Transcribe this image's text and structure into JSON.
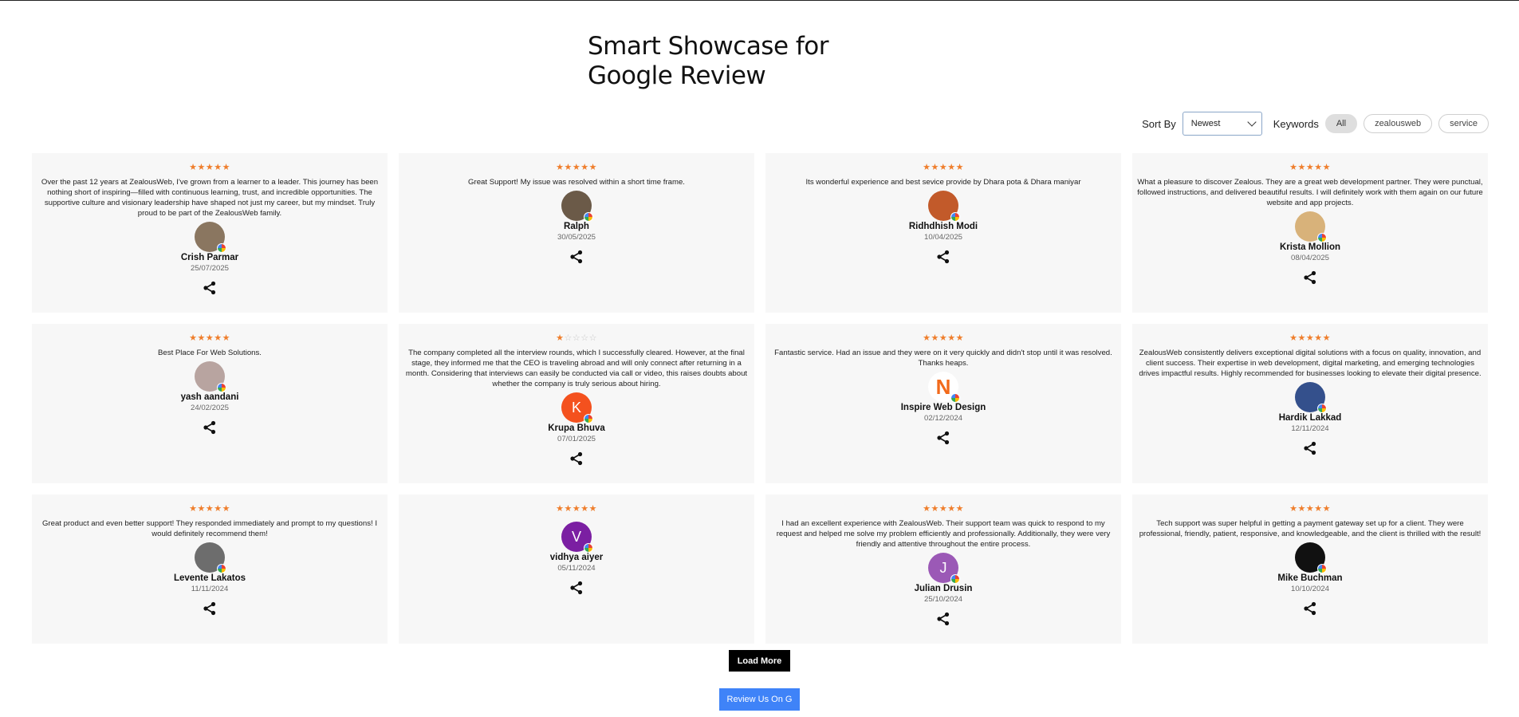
{
  "title": {
    "line1": "Smart Showcase for",
    "line2": "Google Review"
  },
  "filters": {
    "sort_label": "Sort By",
    "sort_value": "Newest",
    "keywords_label": "Keywords",
    "chips": [
      "All",
      "zealousweb",
      "service"
    ]
  },
  "reviews": [
    {
      "rating": 5,
      "text": "Over the past 12 years at ZealousWeb, I've grown from a learner to a leader. This journey has been nothing short of inspiring—filled with continuous learning, trust, and incredible opportunities. The supportive culture and visionary leadership have shaped not just my career, but my mindset. Truly proud to be part of the ZealousWeb family.",
      "name": "Crish Parmar",
      "date": "25/07/2025",
      "avatar_color": "#8a7660",
      "initial": ""
    },
    {
      "rating": 5,
      "text": "Great Support! My issue was resolved within a short time frame.",
      "name": "Ralph",
      "date": "30/05/2025",
      "avatar_color": "#6b5a48",
      "initial": ""
    },
    {
      "rating": 5,
      "text": "Its wonderful experience and best sevice provide by Dhara pota & Dhara maniyar",
      "name": "Ridhdhish Modi",
      "date": "10/04/2025",
      "avatar_color": "#c25a2a",
      "initial": ""
    },
    {
      "rating": 5,
      "text": "What a pleasure to discover Zealous. They are a great web development partner. They were punctual, followed instructions, and delivered beautiful results. I will definitely work with them again on our future website and app projects.",
      "name": "Krista Mollion",
      "date": "08/04/2025",
      "avatar_color": "#d8b27a",
      "initial": ""
    },
    {
      "rating": 5,
      "text": "Best Place For Web Solutions.",
      "name": "yash aandani",
      "date": "24/02/2025",
      "avatar_color": "#b8a4a0",
      "initial": ""
    },
    {
      "rating": 1,
      "text": "The company completed all the interview rounds, which I successfully cleared. However, at the final stage, they informed me that the CEO is traveling abroad and will only connect after returning in a month. Considering that interviews can easily be conducted via call or video, this raises doubts about whether the company is truly serious about hiring.",
      "name": "Krupa Bhuva",
      "date": "07/01/2025",
      "avatar_color": "#f4511e",
      "initial": "K"
    },
    {
      "rating": 5,
      "text": "Fantastic service. Had an issue and they were on it very quickly and didn't stop until it was resolved. Thanks heaps.",
      "name": "Inspire Web Design",
      "date": "02/12/2024",
      "avatar_color": "#ffffff",
      "initial": "N"
    },
    {
      "rating": 5,
      "text": "ZealousWeb consistently delivers exceptional digital solutions with a focus on quality, innovation, and client success. Their expertise in web development, digital marketing, and emerging technologies drives impactful results. Highly recommended for businesses looking to elevate their digital presence.",
      "name": "Hardik Lakkad",
      "date": "12/11/2024",
      "avatar_color": "#34508c",
      "initial": ""
    },
    {
      "rating": 5,
      "text": "Great product and even better support! They responded immediately and prompt to my questions! I would definitely recommend them!",
      "name": "Levente Lakatos",
      "date": "11/11/2024",
      "avatar_color": "#6d6d6d",
      "initial": ""
    },
    {
      "rating": 5,
      "text": "",
      "name": "vidhya aiyer",
      "date": "05/11/2024",
      "avatar_color": "#7b1fa2",
      "initial": "V"
    },
    {
      "rating": 5,
      "text": "I had an excellent experience with ZealousWeb. Their support team was quick to respond to my request and helped me solve my problem efficiently and professionally. Additionally, they were very friendly and attentive throughout the entire process.",
      "name": "Julian Drusin",
      "date": "25/10/2024",
      "avatar_color": "#9b59b6",
      "initial": "J"
    },
    {
      "rating": 5,
      "text": "Tech support was super helpful in getting a payment gateway set up for a client. They were professional, friendly, patient, responsive, and knowledgeable, and the client is thrilled with the result!",
      "name": "Mike Buchman",
      "date": "10/10/2024",
      "avatar_color": "#111111",
      "initial": ""
    }
  ],
  "buttons": {
    "load_more": "Load More",
    "review_us": "Review Us On G"
  }
}
